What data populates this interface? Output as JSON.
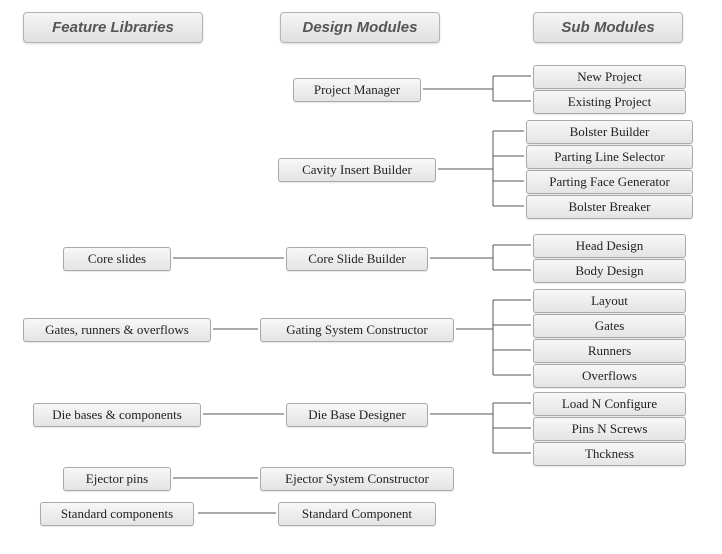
{
  "headers": {
    "feature": "Feature Libraries",
    "design": "Design Modules",
    "sub": "Sub Modules"
  },
  "feature": {
    "core_slides": "Core slides",
    "gating": "Gates, runners & overflows",
    "die_bases": "Die bases & components",
    "ejector": "Ejector pins",
    "standard": "Standard components"
  },
  "design": {
    "project": "Project Manager",
    "cavity": "Cavity Insert Builder",
    "core": "Core Slide Builder",
    "gating": "Gating System Constructor",
    "die": "Die Base Designer",
    "ejector": "Ejector System Constructor",
    "standard": "Standard Component"
  },
  "sub": {
    "project": [
      "New Project",
      "Existing Project"
    ],
    "cavity": [
      "Bolster Builder",
      "Parting Line Selector",
      "Parting Face Generator",
      "Bolster Breaker"
    ],
    "core": [
      "Head Design",
      "Body Design"
    ],
    "gating": [
      "Layout",
      "Gates",
      "Runners",
      "Overflows"
    ],
    "die": [
      "Load N Configure",
      "Pins N Screws",
      "Thckness"
    ]
  }
}
